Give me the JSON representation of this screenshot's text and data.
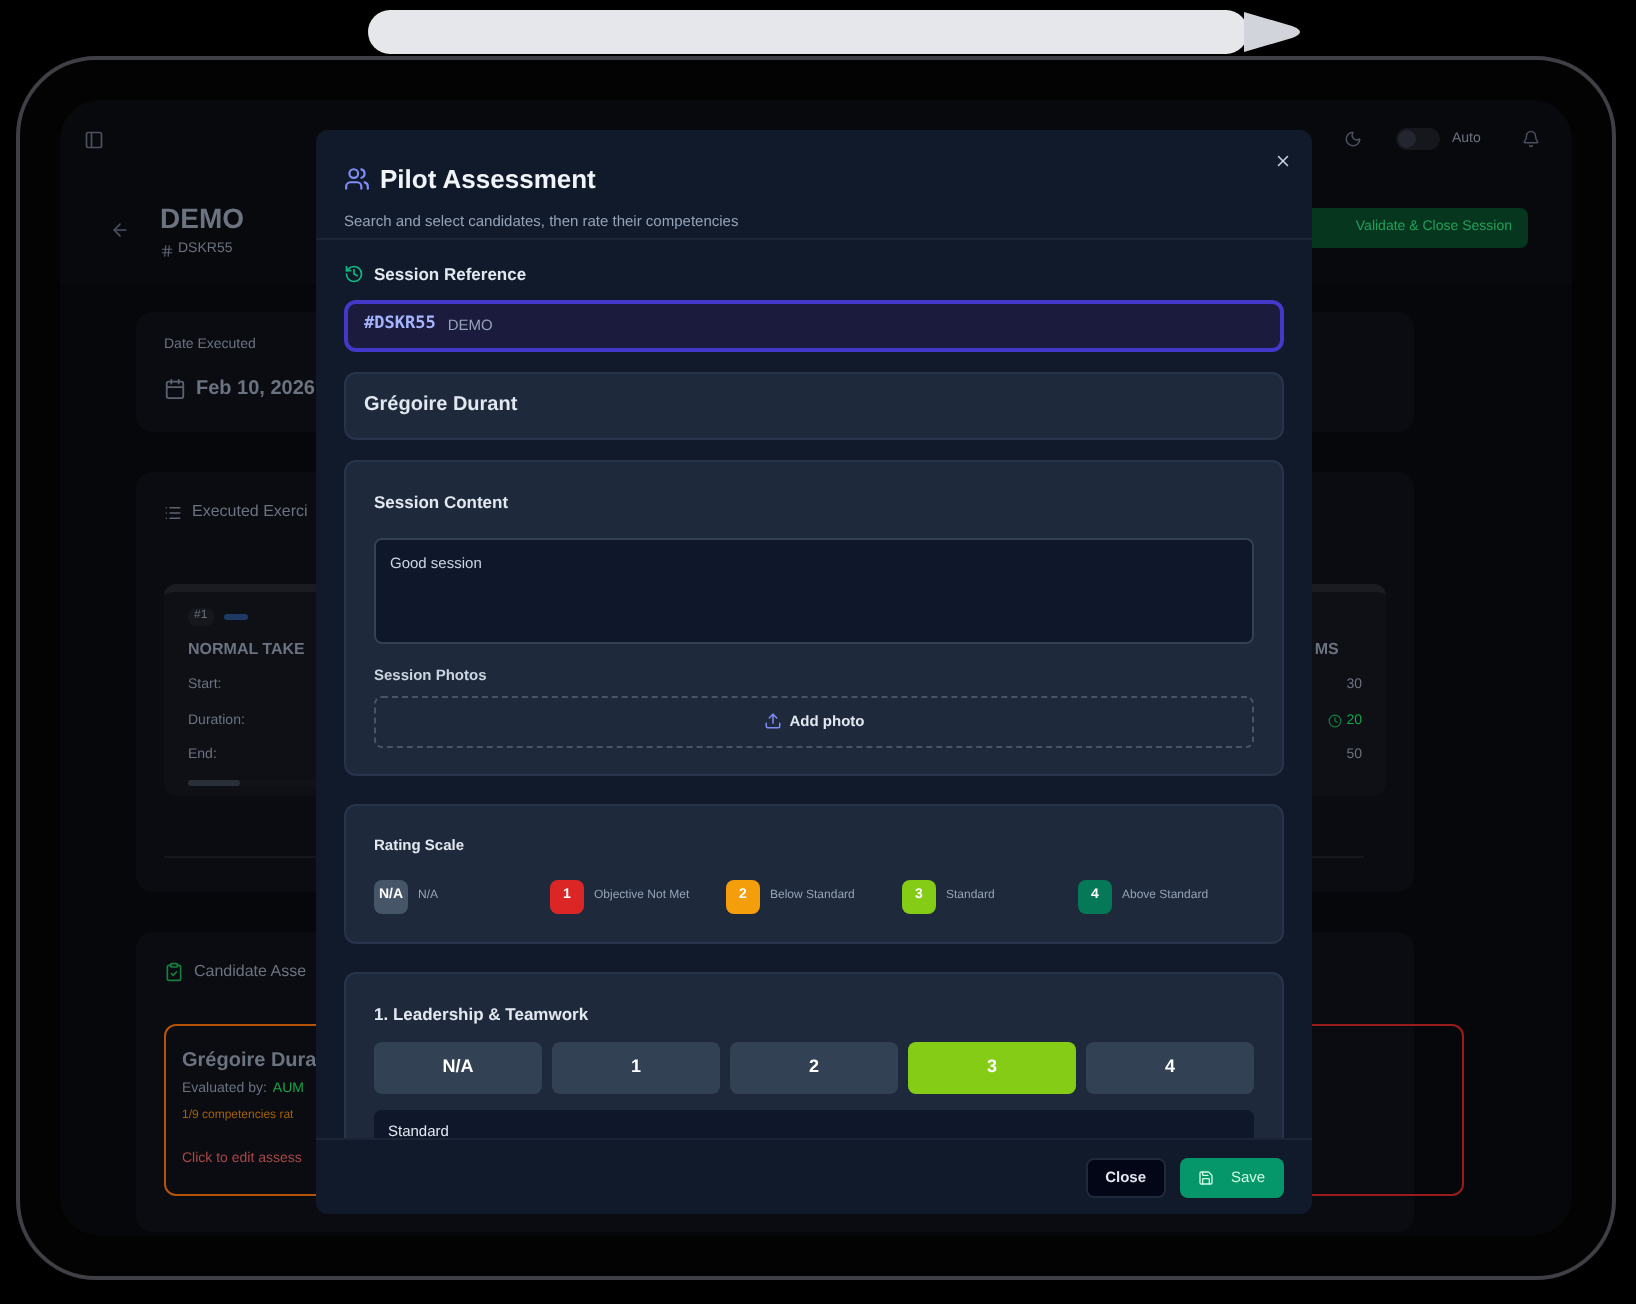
{
  "app": {
    "header": {
      "title": "DEMO",
      "reference": "DSKR55",
      "theme_toggle": {
        "on": false
      },
      "theme_label": "Auto",
      "primary_button": "Validate & Close Session"
    },
    "date_card": {
      "label": "Date Executed",
      "value": "Feb 10, 2026"
    },
    "exercises": {
      "title": "Executed Exerci",
      "card": {
        "number": "#1",
        "name": "NORMAL TAKE",
        "name_end": "MS",
        "rows": [
          {
            "label": "Start:",
            "value": "30",
            "kind": "plain"
          },
          {
            "label": "Duration:",
            "value": "20",
            "kind": "timed"
          },
          {
            "label": "End:",
            "value": "50",
            "kind": "plain"
          }
        ],
        "progress": {
          "level": 0.25
        }
      }
    },
    "candidates": {
      "title": "Candidate Asse",
      "cards": [
        {
          "name": "Grégoire Dura",
          "evaluated_label": "Evaluated by:",
          "evaluator": "AUM",
          "progress": "1/9 competencies rat",
          "hint": "Click to edit assess",
          "color": "#b45309"
        },
        {
          "color": "#991b1b"
        }
      ]
    }
  },
  "modal": {
    "title": "Pilot Assessment",
    "subtitle": "Search and select candidates, then rate their competencies",
    "session_reference": {
      "label": "Session Reference",
      "code": "#DSKR55",
      "name": "DEMO"
    },
    "candidate": "Grégoire Durant",
    "session_content": {
      "title": "Session Content",
      "notes": "Good session",
      "photos_label": "Session Photos",
      "add_photo": "Add photo"
    },
    "rating_scale": {
      "title": "Rating Scale",
      "levels": [
        {
          "badge": "N/A",
          "label": "N/A",
          "color": "#475569"
        },
        {
          "badge": "1",
          "label": "Objective Not Met",
          "color": "#dc2626"
        },
        {
          "badge": "2",
          "label": "Below Standard",
          "color": "#f59e0b"
        },
        {
          "badge": "3",
          "label": "Standard",
          "color": "#84cc16"
        },
        {
          "badge": "4",
          "label": "Above Standard",
          "color": "#047857"
        }
      ]
    },
    "competencies": [
      {
        "title": "1. Leadership & Teamwork",
        "options": [
          {
            "label": "N/A",
            "selected": false
          },
          {
            "label": "1",
            "selected": false
          },
          {
            "label": "2",
            "selected": false
          },
          {
            "label": "3",
            "selected": true
          },
          {
            "label": "4",
            "selected": false
          }
        ],
        "comment": "Standard"
      }
    ],
    "footer": {
      "close": "Close",
      "save": "Save"
    }
  }
}
